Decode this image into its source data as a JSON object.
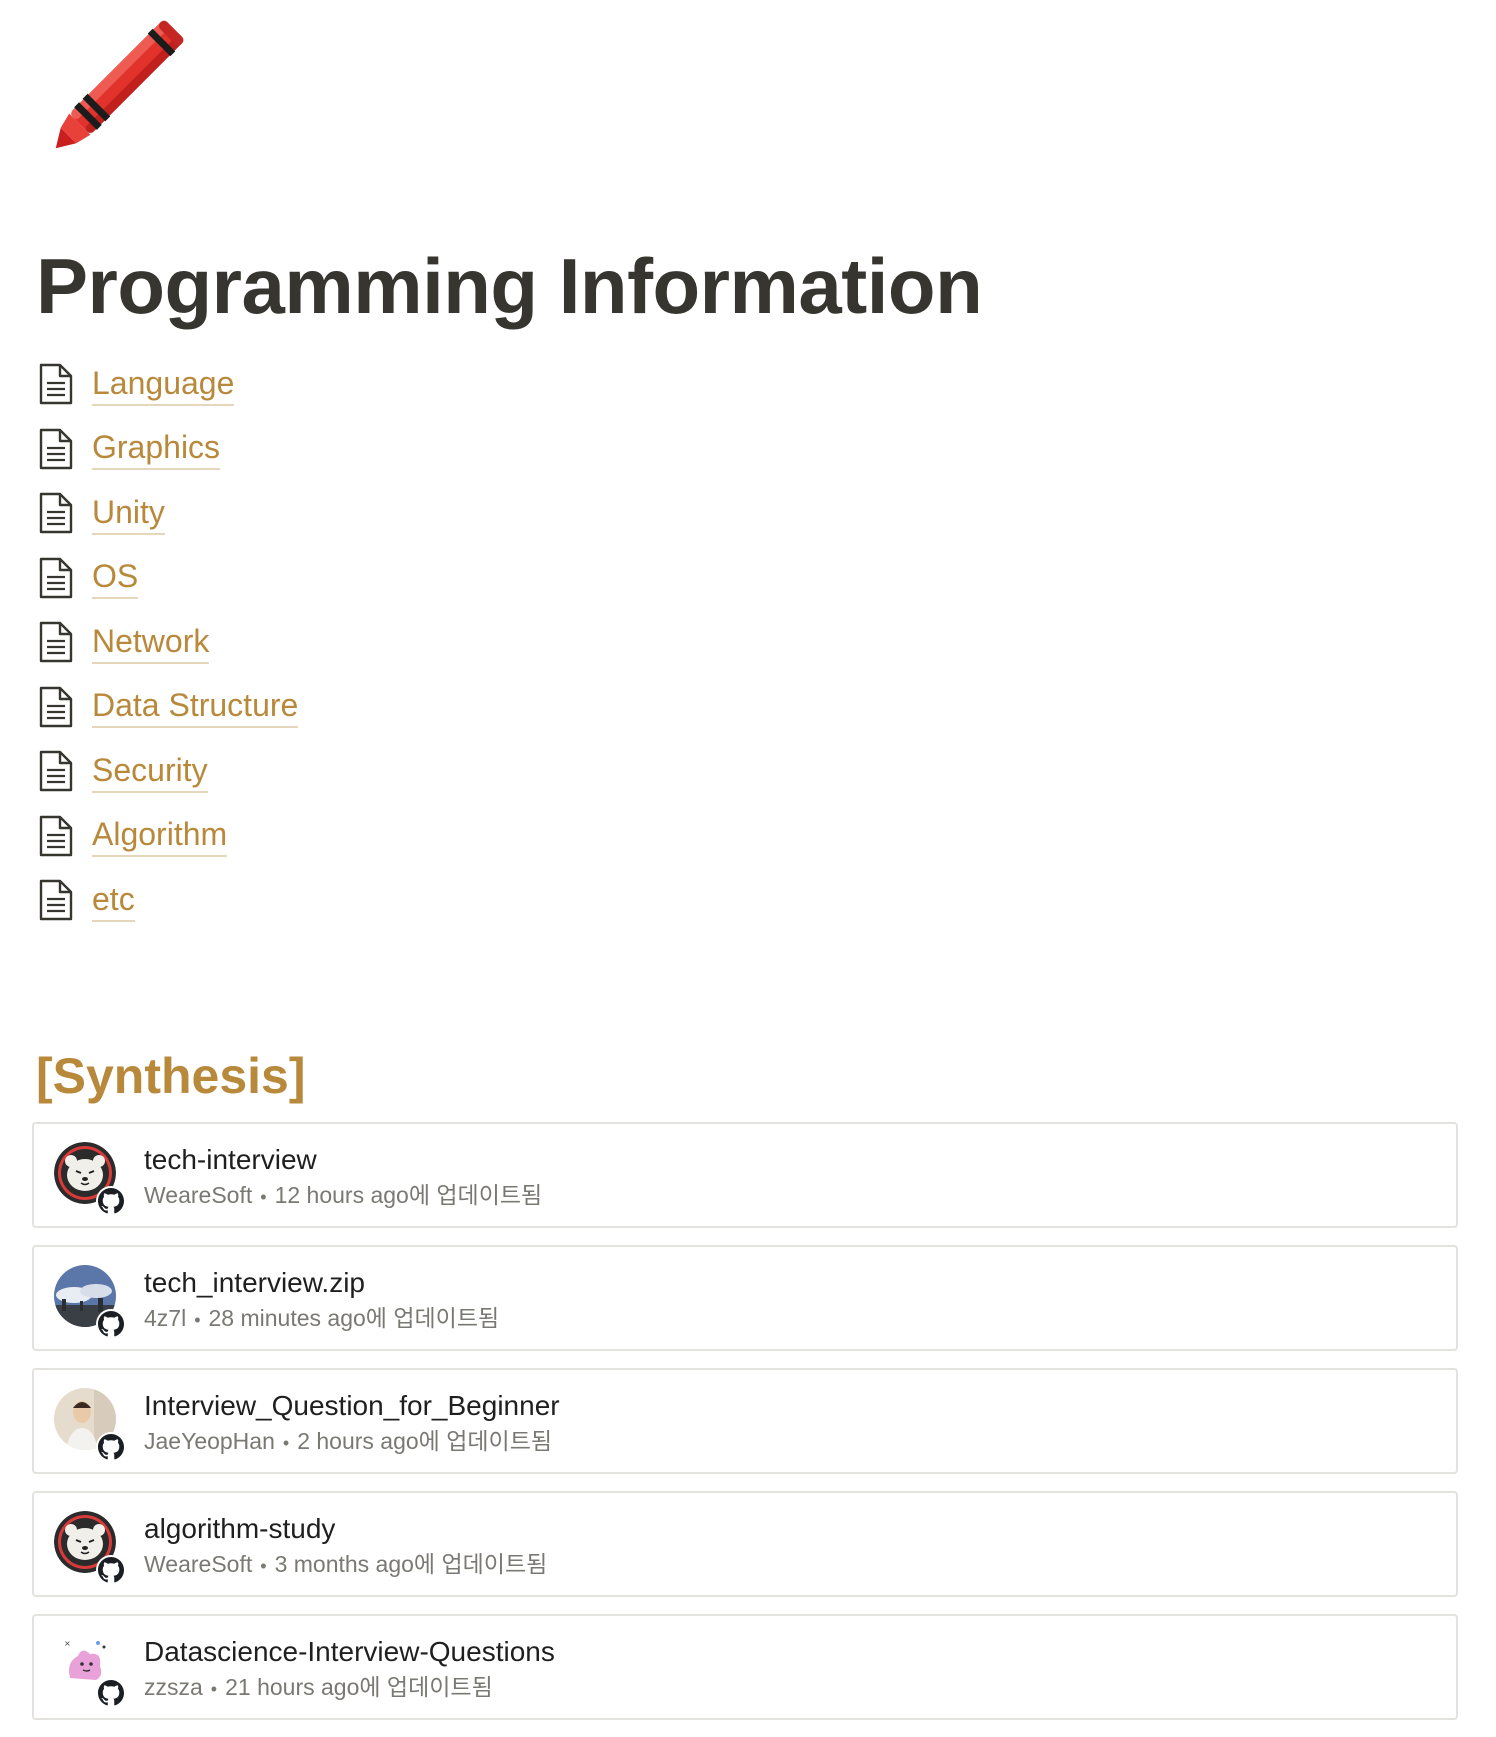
{
  "page": {
    "icon": "crayon-icon",
    "title": "Programming Information"
  },
  "links": [
    {
      "label": "Language",
      "icon": "document-icon"
    },
    {
      "label": "Graphics",
      "icon": "document-icon"
    },
    {
      "label": "Unity",
      "icon": "document-icon"
    },
    {
      "label": "OS",
      "icon": "document-icon"
    },
    {
      "label": "Network",
      "icon": "document-icon"
    },
    {
      "label": "Data Structure",
      "icon": "document-icon"
    },
    {
      "label": "Security",
      "icon": "document-icon"
    },
    {
      "label": "Algorithm",
      "icon": "document-icon"
    },
    {
      "label": "etc",
      "icon": "document-icon"
    }
  ],
  "section": {
    "heading": "[Synthesis]"
  },
  "repos": [
    {
      "name": "tech-interview",
      "owner": "WeareSoft",
      "sep": "•",
      "updated": "12 hours ago에 업데이트됨",
      "avatar": "polar-bear-avatar"
    },
    {
      "name": "tech_interview.zip",
      "owner": "4z7l",
      "sep": "•",
      "updated": "28 minutes ago에 업데이트됨",
      "avatar": "sky-photo-avatar"
    },
    {
      "name": "Interview_Question_for_Beginner",
      "owner": "JaeYeopHan",
      "sep": "•",
      "updated": "2 hours ago에 업데이트됨",
      "avatar": "person-photo-avatar"
    },
    {
      "name": "algorithm-study",
      "owner": "WeareSoft",
      "sep": "•",
      "updated": "3 months ago에 업데이트됨",
      "avatar": "polar-bear-avatar"
    },
    {
      "name": "Datascience-Interview-Questions",
      "owner": "zzsza",
      "sep": "•",
      "updated": "21 hours ago에 업데이트됨",
      "avatar": "pink-creature-avatar"
    }
  ],
  "colors": {
    "link": "#b8893b",
    "title": "#37352f",
    "meta": "#7a7873",
    "border": "#e3e2df"
  }
}
